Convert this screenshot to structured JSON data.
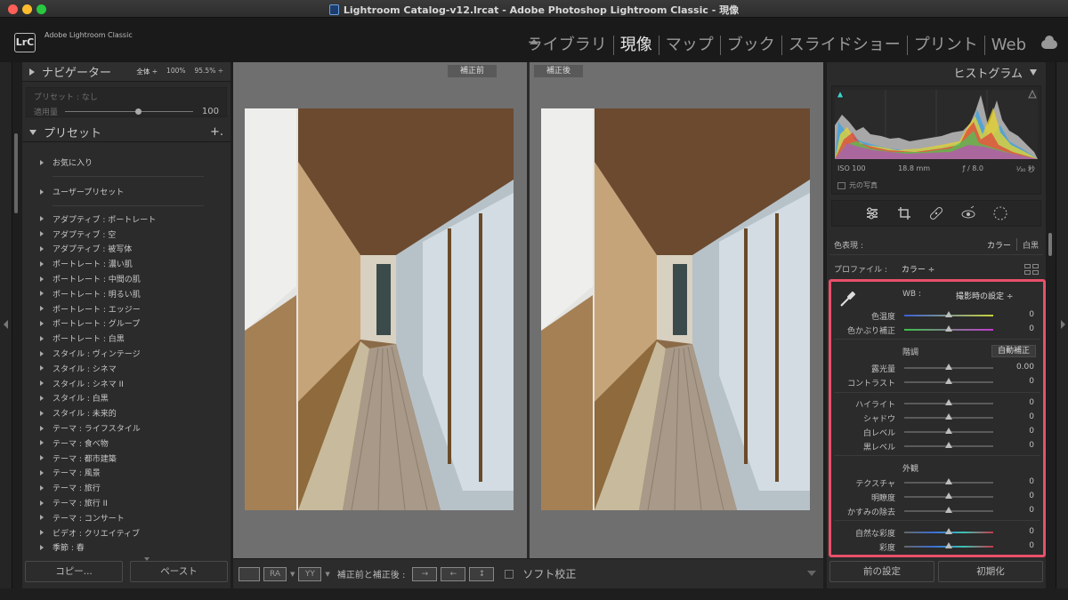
{
  "window": {
    "title": "Lightroom Catalog-v12.lrcat - Adobe Photoshop Lightroom Classic - 現像"
  },
  "header": {
    "app_badge": "LrC",
    "app_name": "Adobe Lightroom Classic",
    "modules": [
      "ライブラリ",
      "現像",
      "マップ",
      "ブック",
      "スライドショー",
      "プリント",
      "Web"
    ],
    "active_module": "現像"
  },
  "navigator": {
    "title": "ナビゲーター",
    "zoom_options": [
      "全体 ÷",
      "100%",
      "95.5% ÷"
    ]
  },
  "preset_amount": {
    "preset_label": "プリセット : なし",
    "amount_label": "適用量",
    "amount_value": "100",
    "amount_fraction": 0.55
  },
  "presets": {
    "title": "プリセット",
    "add": "+.",
    "groups": [
      "お気に入り",
      "ユーザープリセット"
    ],
    "items": [
      "アダプティブ : ポートレート",
      "アダプティブ : 空",
      "アダプティブ : 被写体",
      "ポートレート : 濃い肌",
      "ポートレート : 中間の肌",
      "ポートレート : 明るい肌",
      "ポートレート : エッジー",
      "ポートレート : グループ",
      "ポートレート : 白黒",
      "スタイル : ヴィンテージ",
      "スタイル : シネマ",
      "スタイル : シネマ II",
      "スタイル : 白黒",
      "スタイル : 未来的",
      "テーマ : ライフスタイル",
      "テーマ : 食べ物",
      "テーマ : 都市建築",
      "テーマ : 風景",
      "テーマ : 旅行",
      "テーマ : 旅行 II",
      "テーマ : コンサート",
      "ビデオ : クリエイティブ",
      "季節 : 春"
    ]
  },
  "left_buttons": {
    "copy": "コピー...",
    "paste": "ペースト"
  },
  "compare": {
    "before": "補正前",
    "after": "補正後"
  },
  "toolbar": {
    "ra": "RA",
    "yy": "YY",
    "before_after_label": "補正前と補正後 :",
    "swap1": "→",
    "swap2": "←",
    "swap3": "↕",
    "soft_proof": "ソフト校正"
  },
  "histogram": {
    "title": "ヒストグラム",
    "iso": "ISO 100",
    "focal": "18.8 mm",
    "aperture": "ƒ / 8.0",
    "shutter": "¹⁄₃₀ 秒",
    "original_photo": "元の写真"
  },
  "basic": {
    "treatment_label": "色表現 :",
    "treatment_color": "カラー",
    "treatment_bw": "白黒",
    "profile_label": "プロファイル :",
    "profile_value": "カラー ÷",
    "wb_label": "WB :",
    "wb_value": "撮影時の設定 ÷",
    "tone_title": "階調",
    "auto": "自動補正",
    "presence_title": "外観",
    "sliders": {
      "temp": {
        "label": "色温度",
        "value": "0"
      },
      "tint": {
        "label": "色かぶり補正",
        "value": "0"
      },
      "exposure": {
        "label": "露光量",
        "value": "0.00"
      },
      "contrast": {
        "label": "コントラスト",
        "value": "0"
      },
      "highlights": {
        "label": "ハイライト",
        "value": "0"
      },
      "shadows": {
        "label": "シャドウ",
        "value": "0"
      },
      "whites": {
        "label": "白レベル",
        "value": "0"
      },
      "blacks": {
        "label": "黒レベル",
        "value": "0"
      },
      "texture": {
        "label": "テクスチャ",
        "value": "0"
      },
      "clarity": {
        "label": "明瞭度",
        "value": "0"
      },
      "dehaze": {
        "label": "かすみの除去",
        "value": "0"
      },
      "vibrance": {
        "label": "自然な彩度",
        "value": "0"
      },
      "saturation": {
        "label": "彩度",
        "value": "0"
      }
    }
  },
  "right_buttons": {
    "previous": "前の設定",
    "reset": "初期化"
  },
  "colors": {
    "highlight_border": "#e8506a",
    "panel_bg": "#2b2b2b",
    "preview_bg": "#6f6f6f"
  }
}
